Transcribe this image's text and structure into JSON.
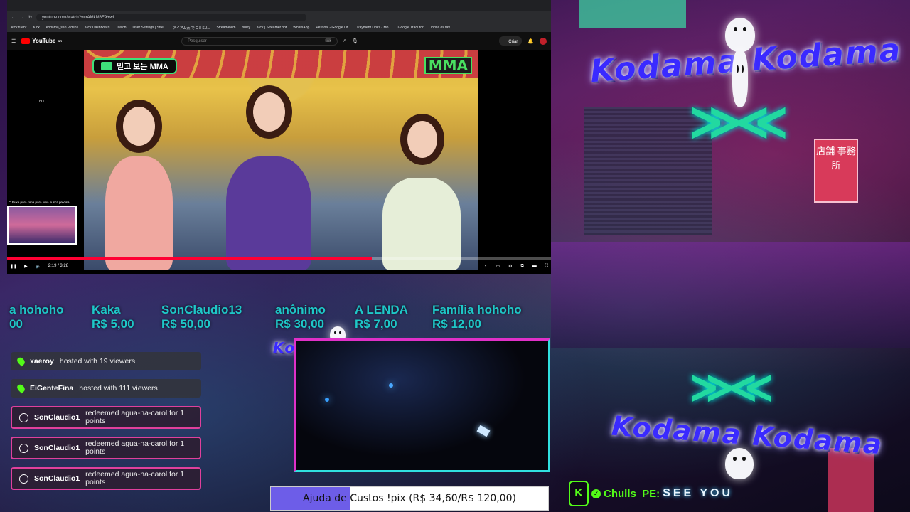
{
  "browser": {
    "url": "youtube.com/watch?v=rAMkM8E9Ywf",
    "bookmarks": [
      "kick fuehr",
      "Kick",
      "kodama_san Videos",
      "Kick Dashboard",
      "Twitch",
      "User Settings | Stre...",
      "アイアム太 で C 8 SU...",
      "Streamelem",
      "nullty",
      "Kick | Streamer.bot",
      "WhatsApp",
      "Pessoal - Google Dr...",
      "Payment Links - Mo...",
      "Google Tradutor",
      "Todos os fav"
    ],
    "yt_logo": "YouTube",
    "yt_region": "BR",
    "search_placeholder": "Pesquisar",
    "create_label": "Criar",
    "video_badge_left": "믿고 보는 MMA",
    "video_badge_right": "MMA",
    "preview_hint": "⌃ Puxe para cima para uma busca precisa",
    "preview_time": "0:11",
    "time_display": "2:19 / 3:28",
    "progress": 0.67
  },
  "ticker": [
    {
      "name": "a hohoho",
      "amount": "00"
    },
    {
      "name": "Kaka",
      "amount": "R$ 5,00"
    },
    {
      "name": "SonClaudio13",
      "amount": "R$ 50,00"
    },
    {
      "name": "anônimo",
      "amount": "R$ 30,00"
    },
    {
      "name": "A LENDA",
      "amount": "R$ 7,00"
    },
    {
      "name": "Família hohoho",
      "amount": "R$ 12,00"
    }
  ],
  "feed": [
    {
      "type": "host",
      "user": "xaeroy",
      "text": "hosted with 19 viewers"
    },
    {
      "type": "host",
      "user": "EiGenteFina",
      "text": "hosted with 111 viewers"
    },
    {
      "type": "redeem",
      "user": "SonClaudio1",
      "text": "redeemed agua-na-carol for 1 points"
    },
    {
      "type": "redeem",
      "user": "SonClaudio1",
      "text": "redeemed agua-na-carol for 1 points"
    },
    {
      "type": "redeem",
      "user": "SonClaudio1",
      "text": "redeemed agua-na-carol for 1 points"
    }
  ],
  "logo_text": "Kodama Kodama",
  "logo_bottom": "Kodama Kodama",
  "sign_text": "店舗 事務所",
  "goal": {
    "label": "Ajuda de Custos !pix (R$ 34,60/R$ 120,00)",
    "fraction": 0.288
  },
  "chat": {
    "badge": "K",
    "user": "Chulls_PE:",
    "message": "SEE YOU"
  },
  "colors": {
    "accent_kick": "#53fc18",
    "ticker": "#1ec8c8",
    "redeem_border": "#e0409c",
    "goal_fill": "#6d5de8"
  }
}
